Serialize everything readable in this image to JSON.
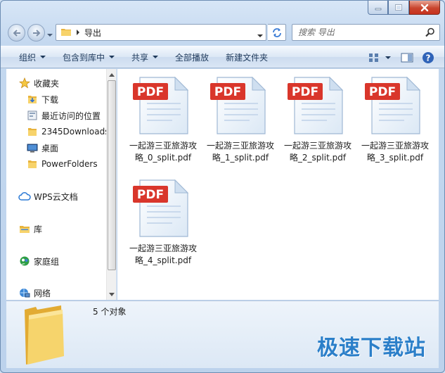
{
  "address": {
    "crumb": "导出"
  },
  "search": {
    "placeholder": "搜索 导出"
  },
  "toolbar": {
    "organize": "组织",
    "include_in_library": "包含到库中",
    "share": "共享",
    "play_all": "全部播放",
    "new_folder": "新建文件夹"
  },
  "nav": {
    "favorites": "收藏夹",
    "downloads": "下载",
    "recent": "最近访问的位置",
    "folder_2345": "2345Downloads",
    "desktop": "桌面",
    "powerfolders": "PowerFolders",
    "wps": "WPS云文档",
    "library": "库",
    "homegroup": "家庭组",
    "network": "网络"
  },
  "files": [
    {
      "name": "一起游三亚旅游攻略_0_split.pdf",
      "badge": "PDF"
    },
    {
      "name": "一起游三亚旅游攻略_1_split.pdf",
      "badge": "PDF"
    },
    {
      "name": "一起游三亚旅游攻略_2_split.pdf",
      "badge": "PDF"
    },
    {
      "name": "一起游三亚旅游攻略_3_split.pdf",
      "badge": "PDF"
    },
    {
      "name": "一起游三亚旅游攻略_4_split.pdf",
      "badge": "PDF"
    }
  ],
  "details": {
    "count": "5 个对象"
  },
  "watermark": "极速下载站",
  "colors": {
    "pdf_badge": "#d9362b",
    "folder_yellow": "#f2c94c",
    "link_blue": "#1e395b"
  }
}
